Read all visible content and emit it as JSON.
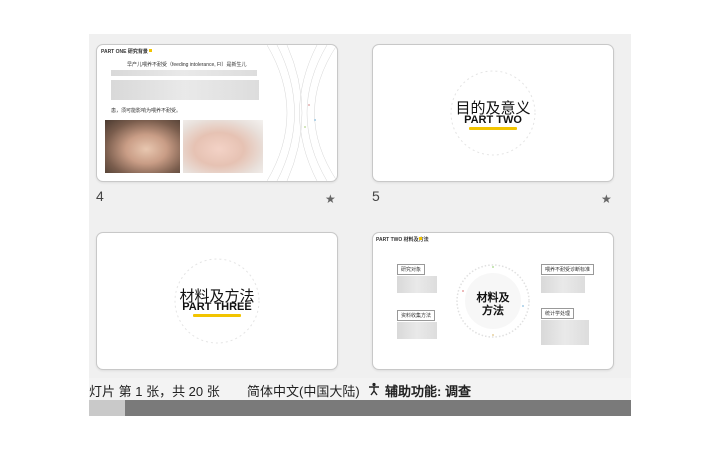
{
  "slides": [
    {
      "number": "4",
      "header": "PART ONE 研究背景",
      "text_line1": "早产儿喂养不耐受（feeding intolerance, FI）是新生儿",
      "text_line2": "患，须可能影响为喂养不耐受。",
      "star": "★"
    },
    {
      "number": "5",
      "title": "目的及意义",
      "part": "PART TWO",
      "star": "★"
    },
    {
      "title": "材料及方法",
      "part": "PART THREE"
    },
    {
      "header": "PART TWO 材料及方法",
      "center_line1": "材料及",
      "center_line2": "方法",
      "box_tl": "研究对象",
      "box_bl": "资料收集方法",
      "box_tr": "喂养不耐受诊断标准",
      "box_br": "统计学处理"
    }
  ],
  "status": {
    "slide_info": "灯片 第 1 张，共 20 张",
    "language": "简体中文(中国大陆)",
    "accessibility": "辅助功能: 调查"
  },
  "colors": {
    "accent": "#f2c400",
    "sorter_bg": "#f0f0f0"
  }
}
